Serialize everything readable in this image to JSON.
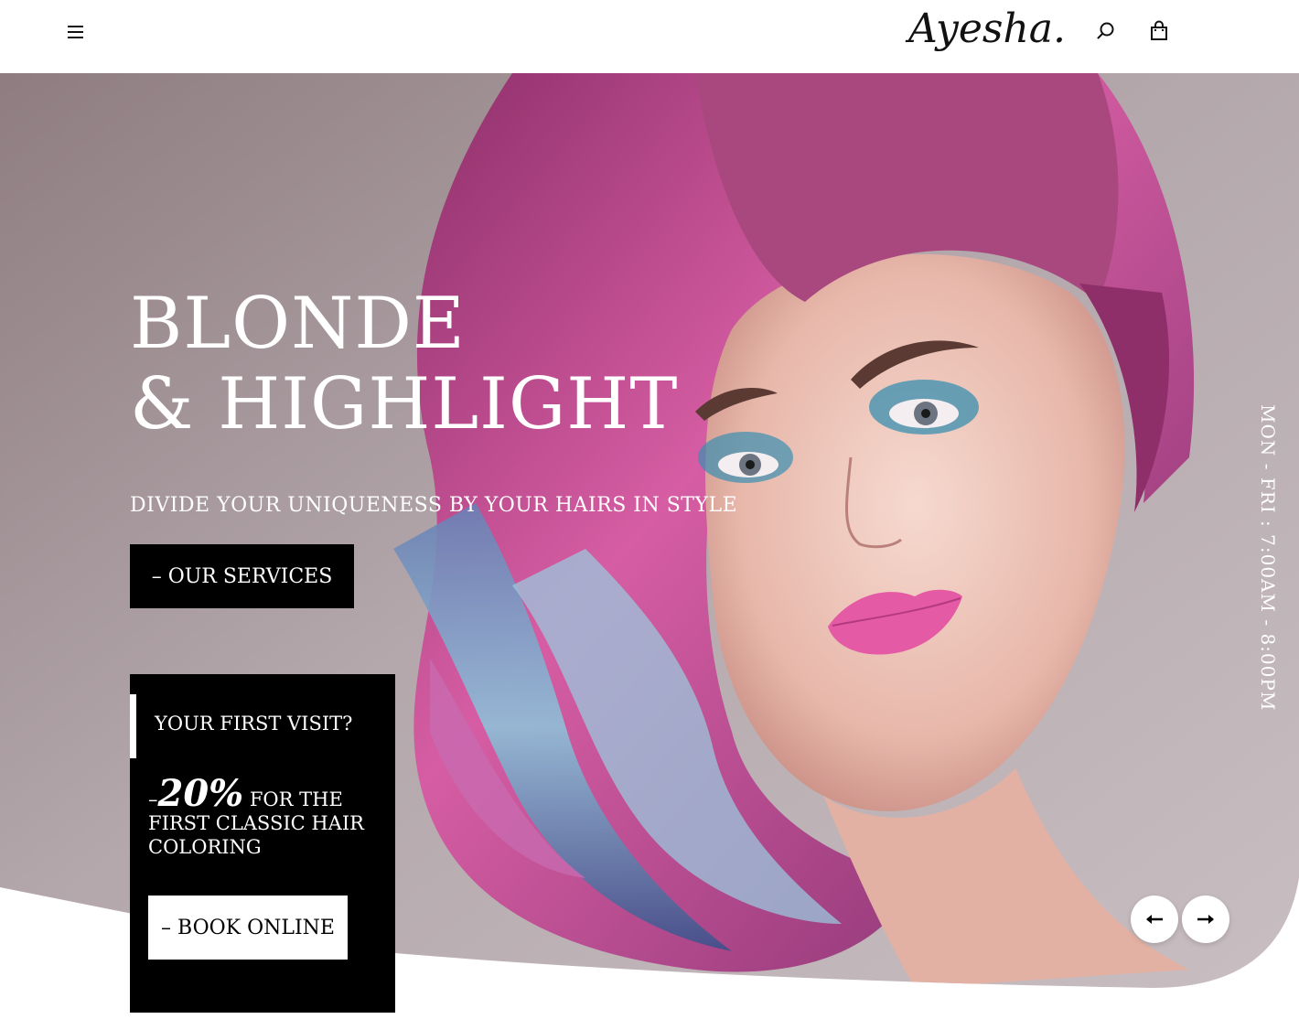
{
  "header": {
    "logo": "Ayesha."
  },
  "hero": {
    "headline_line1": "BLONDE",
    "headline_line2": "& HIGHLIGHT",
    "tagline": "DIVIDE YOUR UNIQUENESS BY YOUR HAIRS IN STYLE",
    "services_button": "– OUR SERVICES",
    "hours": "MON - FRI : 7:00AM - 8:00PM"
  },
  "promo": {
    "heading": "YOUR FIRST VISIT?",
    "dash": "–",
    "discount": "20%",
    "offer_text": " FOR THE FIRST CLASSIC HAIR COLORING",
    "book_button": "– BOOK ONLINE"
  },
  "icons": {
    "menu": "hamburger-icon",
    "search": "search-icon",
    "cart": "shopping-bag-icon",
    "prev": "arrow-left-icon",
    "next": "arrow-right-icon"
  },
  "colors": {
    "background": "#ffffff",
    "hero_bg": "#a89c9f",
    "buttons_dark": "#000000",
    "text_light": "#ffffff"
  }
}
